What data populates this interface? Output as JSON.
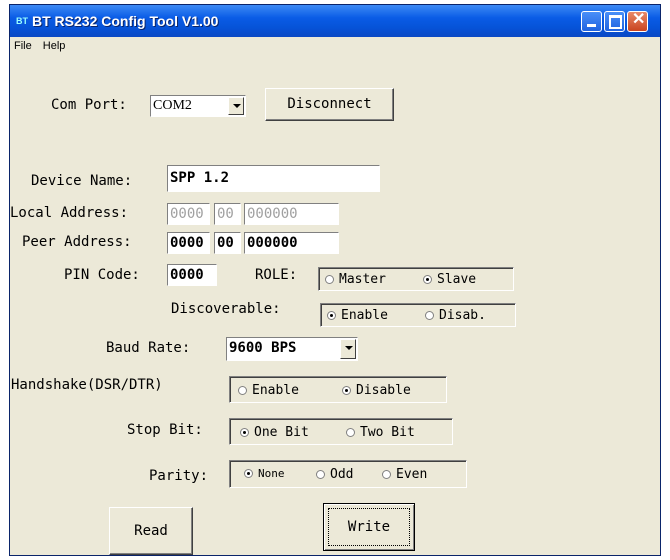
{
  "window": {
    "title": "BT RS232 Config Tool  V1.00",
    "app_icon": "app-icon"
  },
  "menu": [
    "File",
    "Help"
  ],
  "com_port": {
    "label": "Com Port:",
    "value": "COM2",
    "button": "Disconnect"
  },
  "device_name": {
    "label": "Device Name:",
    "value": "SPP 1.2"
  },
  "local_address": {
    "label": "Local Address:",
    "part1": "0000",
    "part2": "00",
    "part3": "000000"
  },
  "peer_address": {
    "label": "Peer Address:",
    "part1": "0000",
    "part2": "00",
    "part3": "000000"
  },
  "pin_code": {
    "label": "PIN Code:",
    "value": "0000"
  },
  "role": {
    "label": "ROLE:",
    "options": [
      "Master",
      "Slave"
    ],
    "selected": "Slave"
  },
  "discoverable": {
    "label": "Discoverable:",
    "options": [
      "Enable",
      "Disab."
    ],
    "selected": "Enable"
  },
  "baud_rate": {
    "label": "Baud Rate:",
    "value": "9600 BPS"
  },
  "handshake": {
    "label": "Handshake(DSR/DTR)",
    "options": [
      "Enable",
      "Disable"
    ],
    "selected": "Disable"
  },
  "stop_bit": {
    "label": "Stop Bit:",
    "options": [
      "One Bit",
      "Two Bit"
    ],
    "selected": "One Bit"
  },
  "parity": {
    "label": "Parity:",
    "options": [
      "None",
      "Odd",
      "Even"
    ],
    "selected": "None"
  },
  "buttons": {
    "read": "Read",
    "write": "Write"
  }
}
